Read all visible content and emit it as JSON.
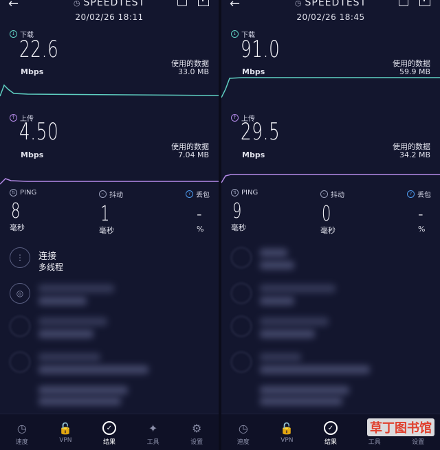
{
  "app": {
    "title": "SPEEDTEST"
  },
  "panels": [
    {
      "datetime": "20/02/26 18:11",
      "download": {
        "label": "下载",
        "value": "22.6",
        "unit": "Mbps",
        "usage_label": "使用的数据",
        "usage_value": "33.0 MB"
      },
      "upload": {
        "label": "上传",
        "value": "4.50",
        "unit": "Mbps",
        "usage_label": "使用的数据",
        "usage_value": "7.04 MB"
      },
      "ping": {
        "label": "PING",
        "value": "8",
        "unit": "毫秒"
      },
      "jitter": {
        "label": "抖动",
        "value": "1",
        "unit": "毫秒"
      },
      "loss": {
        "label": "丢包",
        "value": "-",
        "unit": "%"
      },
      "connection": {
        "title": "连接",
        "subtitle": "多线程"
      }
    },
    {
      "datetime": "20/02/26 18:45",
      "download": {
        "label": "下载",
        "value": "91.0",
        "unit": "Mbps",
        "usage_label": "使用的数据",
        "usage_value": "59.9 MB"
      },
      "upload": {
        "label": "上传",
        "value": "29.5",
        "unit": "Mbps",
        "usage_label": "使用的数据",
        "usage_value": "34.2 MB"
      },
      "ping": {
        "label": "PING",
        "value": "9",
        "unit": "毫秒"
      },
      "jitter": {
        "label": "抖动",
        "value": "0",
        "unit": "毫秒"
      },
      "loss": {
        "label": "丢包",
        "value": "-",
        "unit": "%"
      }
    }
  ],
  "nav": {
    "items": [
      {
        "label": "速度",
        "icon": "speedometer-icon"
      },
      {
        "label": "VPN",
        "icon": "lock-icon"
      },
      {
        "label": "结果",
        "icon": "check-circle-icon"
      },
      {
        "label": "工具",
        "icon": "wand-icon"
      },
      {
        "label": "设置",
        "icon": "gear-icon"
      }
    ]
  },
  "watermark": {
    "text": "草丁图书馆"
  },
  "colors": {
    "download": "#5fd0c2",
    "upload": "#b48ae8",
    "background": "#13162e"
  }
}
